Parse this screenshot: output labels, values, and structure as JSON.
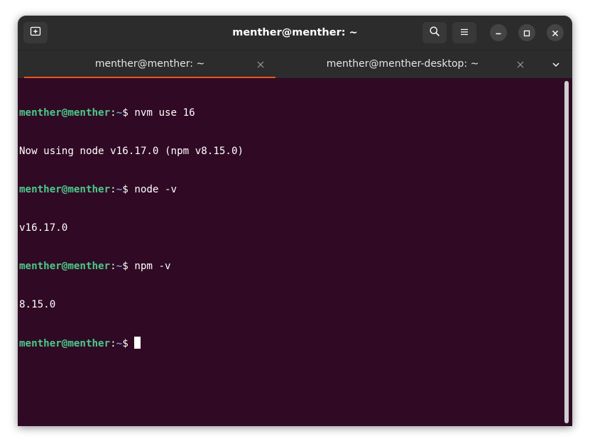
{
  "window": {
    "title": "menther@menther: ~"
  },
  "tabs": [
    {
      "label": "menther@menther: ~",
      "active": true
    },
    {
      "label": "menther@menther-desktop: ~",
      "active": false
    }
  ],
  "colors": {
    "terminal_bg": "#300a24",
    "prompt_user": "#4bc98a",
    "prompt_path": "#6c9bd2",
    "accent": "#e95420"
  },
  "icons": {
    "new_tab": "new-tab-icon",
    "search": "search-icon",
    "menu": "hamburger-menu-icon",
    "minimize": "minimize-icon",
    "maximize": "maximize-icon",
    "close": "close-icon",
    "tab_close": "close-icon",
    "tab_dropdown": "chevron-down-icon"
  },
  "terminal": {
    "lines": [
      {
        "user": "menther@menther",
        "sep": ":",
        "path": "~",
        "sym": "$ ",
        "cmd": "nvm use 16"
      },
      {
        "output": "Now using node v16.17.0 (npm v8.15.0)"
      },
      {
        "user": "menther@menther",
        "sep": ":",
        "path": "~",
        "sym": "$ ",
        "cmd": "node -v"
      },
      {
        "output": "v16.17.0"
      },
      {
        "user": "menther@menther",
        "sep": ":",
        "path": "~",
        "sym": "$ ",
        "cmd": "npm -v"
      },
      {
        "output": "8.15.0"
      },
      {
        "user": "menther@menther",
        "sep": ":",
        "path": "~",
        "sym": "$ ",
        "cmd": ""
      }
    ]
  }
}
